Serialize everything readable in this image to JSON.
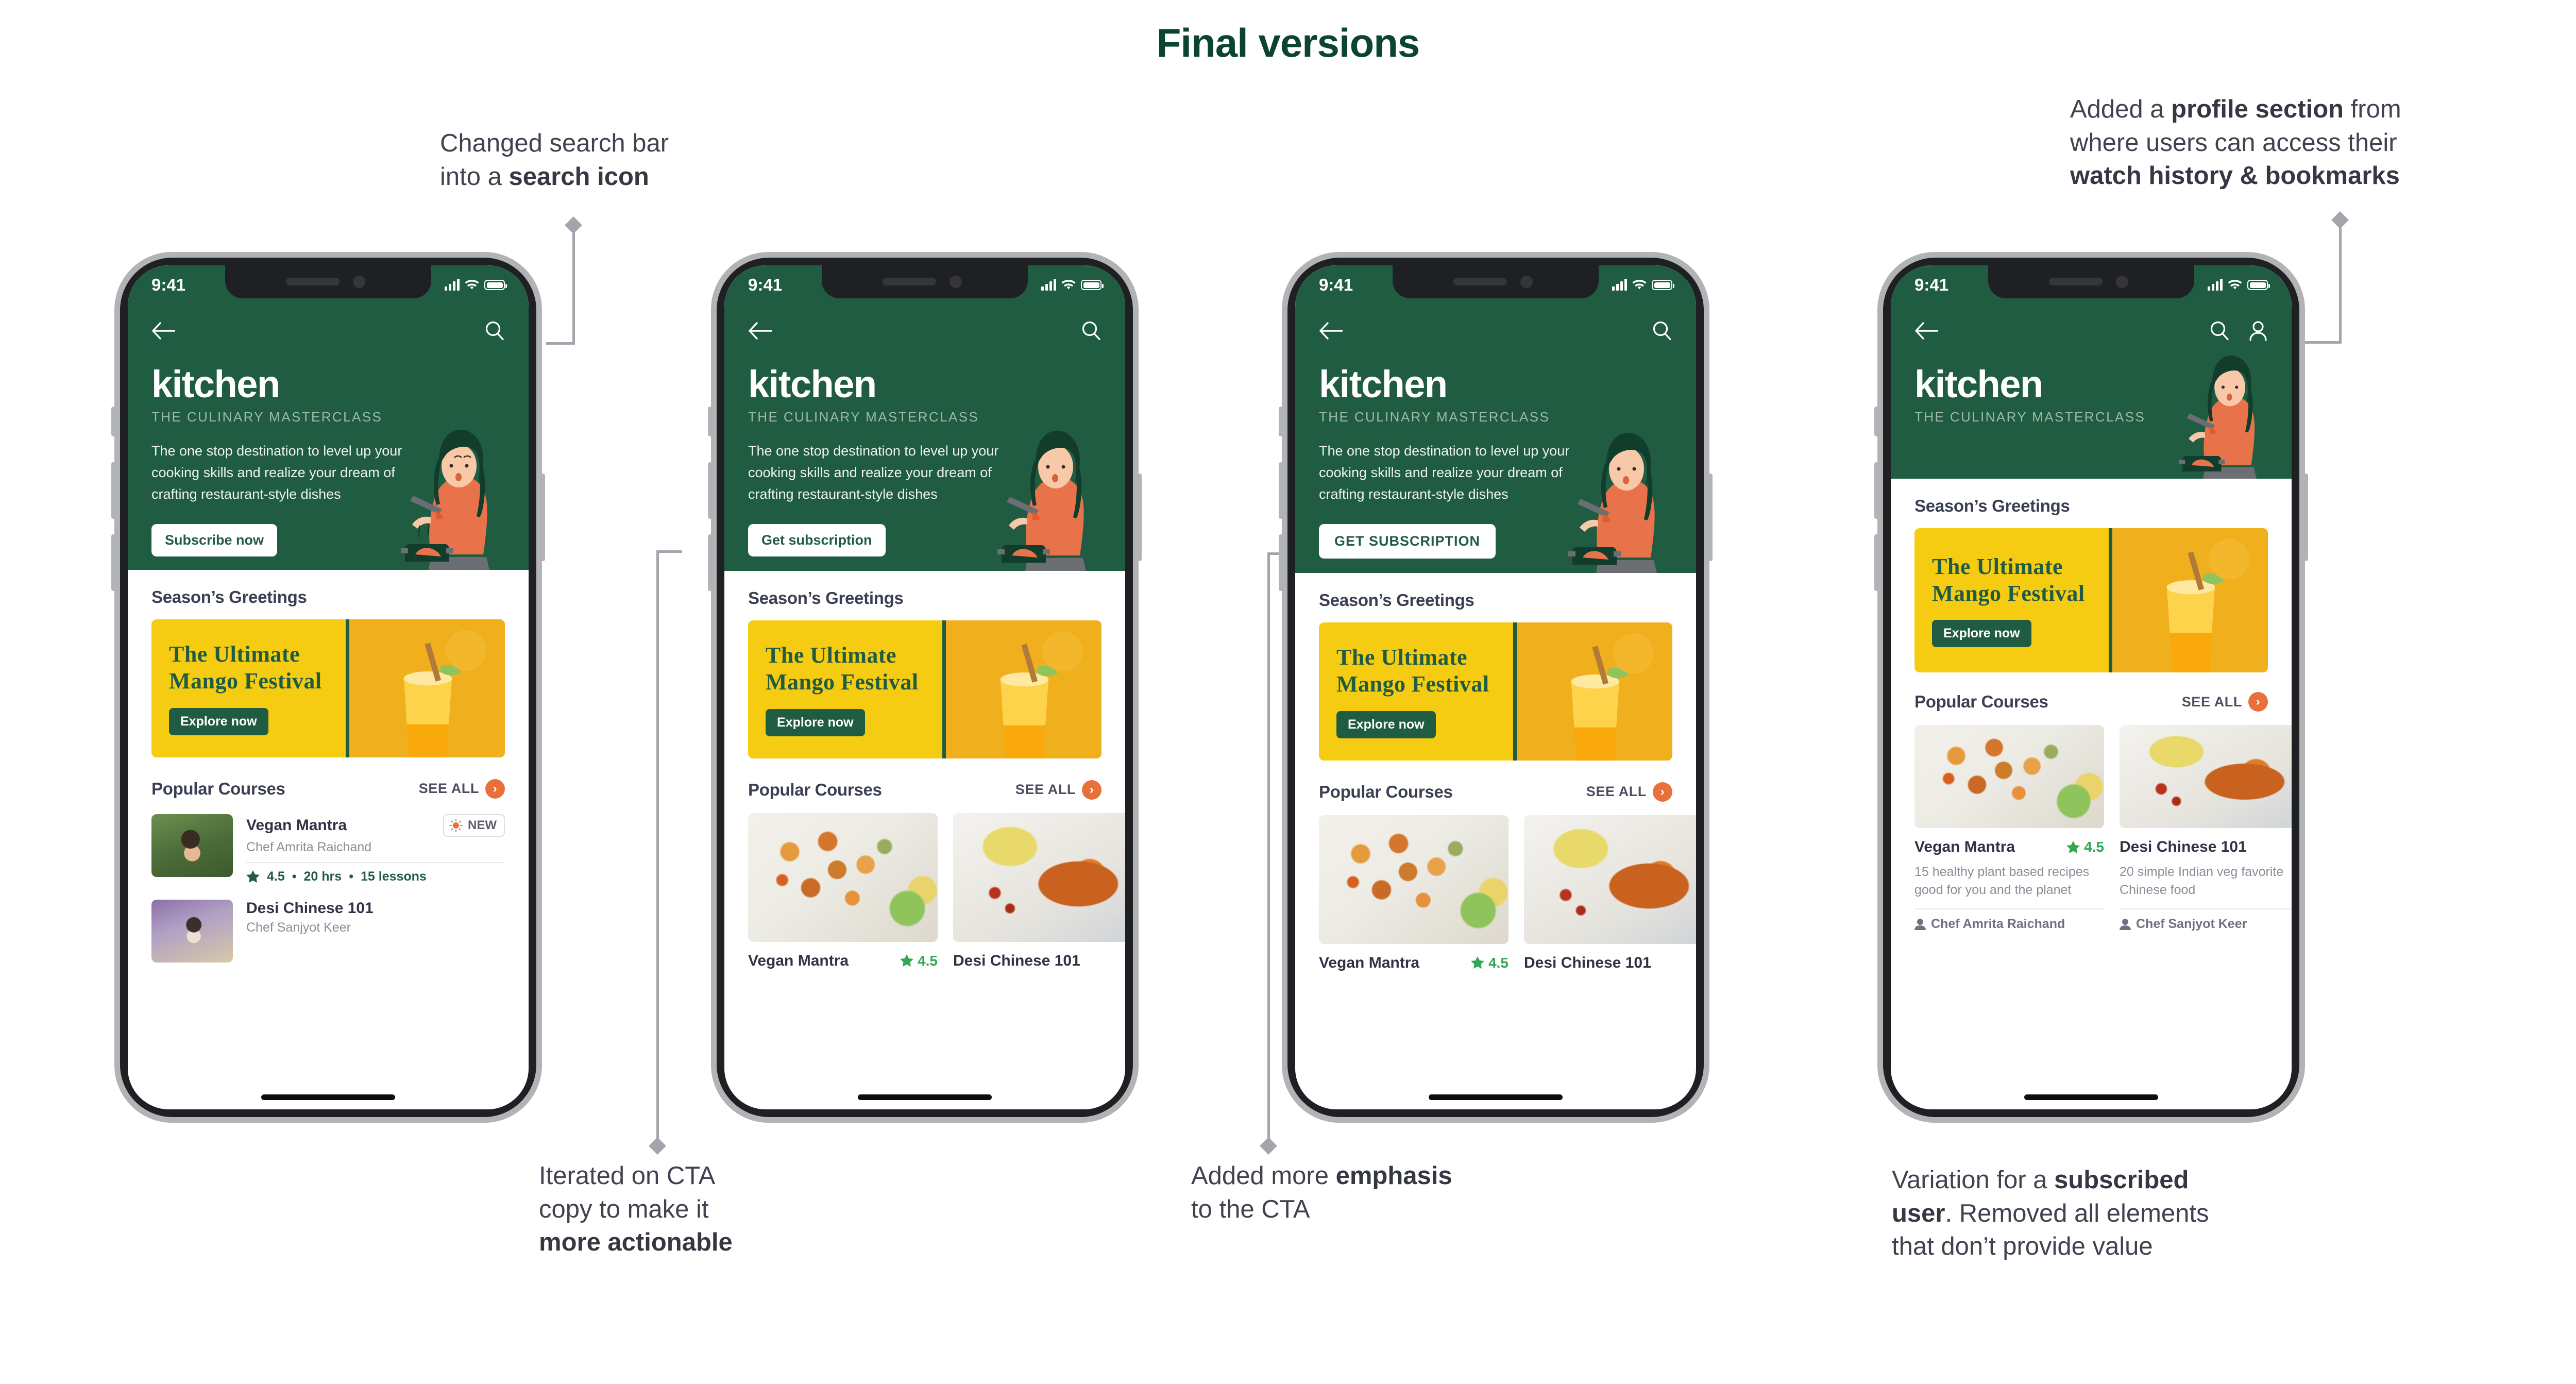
{
  "page": {
    "title": "Final versions"
  },
  "annotations": [
    {
      "id": "search-icon-note",
      "lines": [
        [
          {
            "t": "Changed search bar",
            "b": false
          }
        ],
        [
          {
            "t": "into a ",
            "b": false
          },
          {
            "t": "search icon",
            "b": true
          }
        ]
      ]
    },
    {
      "id": "profile-section-note",
      "lines": [
        [
          {
            "t": "Added a ",
            "b": false
          },
          {
            "t": "profile section",
            "b": true
          },
          {
            "t": " from",
            "b": false
          }
        ],
        [
          {
            "t": "where users can access their",
            "b": false
          }
        ],
        [
          {
            "t": "watch history & bookmarks",
            "b": true
          }
        ]
      ]
    },
    {
      "id": "cta-copy-note",
      "lines": [
        [
          {
            "t": "Iterated on CTA",
            "b": false
          }
        ],
        [
          {
            "t": "copy to make it",
            "b": false
          }
        ],
        [
          {
            "t": "more actionable",
            "b": true
          }
        ]
      ]
    },
    {
      "id": "cta-emphasis-note",
      "lines": [
        [
          {
            "t": "Added more ",
            "b": false
          },
          {
            "t": "emphasis",
            "b": true
          }
        ],
        [
          {
            "t": "to the CTA",
            "b": false
          }
        ]
      ]
    },
    {
      "id": "subscribed-user-note",
      "lines": [
        [
          {
            "t": "Variation for a ",
            "b": false
          },
          {
            "t": "subscribed",
            "b": true
          }
        ],
        [
          {
            "t": "user",
            "b": true
          },
          {
            "t": ". Removed all elements",
            "b": false
          }
        ],
        [
          {
            "t": "that don’t provide value",
            "b": false
          }
        ]
      ]
    }
  ],
  "colors": {
    "brand_green": "#1f5c42",
    "title_green": "#0b4430",
    "banner_yellow": "#f5cc12",
    "accent_orange": "#e8703a",
    "rating_green": "#32a852",
    "text_dark": "#2f3345",
    "text_muted": "#8b8e99",
    "annotation_grey": "#40434f",
    "connector_grey": "#a3a5ab"
  },
  "status_bar": {
    "time": "9:41",
    "icons": [
      "signal-bars-icon",
      "wifi-icon",
      "battery-icon"
    ]
  },
  "app": {
    "back_icon": "back-arrow-icon",
    "search_icon": "search-icon",
    "profile_icon": "profile-icon",
    "brand": "kitchen",
    "tagline": "THE CULINARY MASTERCLASS",
    "description": "The one stop destination to level up your cooking skills and realize your dream of crafting restaurant-style dishes",
    "seasons_title": "Season’s Greetings",
    "banner": {
      "title_line1": "The Ultimate",
      "title_line2": "Mango Festival",
      "button": "Explore now"
    },
    "popular_title": "Popular Courses",
    "see_all": "SEE ALL",
    "see_all_arrow": "chevron-right-icon"
  },
  "phones": [
    {
      "id": "phone-1",
      "cta_label": "Subscribe now",
      "cta_style": "sentence-case",
      "has_profile_icon": false,
      "has_description": true,
      "course_layout": "list",
      "courses": [
        {
          "name": "Vegan Mantra",
          "chef": "Chef Amrita Raichand",
          "badge": "NEW",
          "badge_icon": "sparkle-sun-icon",
          "rating": "4.5",
          "duration": "20 hrs",
          "lessons": "15 lessons",
          "thumb": "food-c"
        },
        {
          "name": "Desi Chinese 101",
          "chef": "Chef Sanjyot Keer",
          "thumb": "food-d"
        }
      ]
    },
    {
      "id": "phone-2",
      "cta_label": "Get subscription",
      "cta_style": "sentence-case",
      "has_profile_icon": false,
      "has_description": true,
      "course_layout": "cards",
      "courses": [
        {
          "name": "Vegan Mantra",
          "rating": "4.5",
          "img": "food-a"
        },
        {
          "name": "Desi Chinese 101",
          "img": "food-b"
        }
      ]
    },
    {
      "id": "phone-3",
      "cta_label": "GET SUBSCRIPTION",
      "cta_style": "uppercase",
      "has_profile_icon": false,
      "has_description": true,
      "course_layout": "cards",
      "courses": [
        {
          "name": "Vegan Mantra",
          "rating": "4.5",
          "img": "food-a"
        },
        {
          "name": "Desi Chinese 101",
          "img": "food-b"
        }
      ]
    },
    {
      "id": "phone-4",
      "cta_label": "",
      "has_profile_icon": true,
      "has_description": false,
      "course_layout": "cards-full",
      "courses": [
        {
          "name": "Vegan Mantra",
          "rating": "4.5",
          "desc": "15 healthy plant based recipes good for you and the planet",
          "chef": "Chef Amrita Raichand",
          "chef_icon": "person-icon",
          "star_icon": "star-icon",
          "img": "food-a"
        },
        {
          "name": "Desi Chinese 101",
          "desc": "20 simple Indian veg favorite Chinese food",
          "chef": "Chef Sanjyot Keer",
          "chef_icon": "person-icon",
          "img": "food-b"
        }
      ]
    }
  ]
}
